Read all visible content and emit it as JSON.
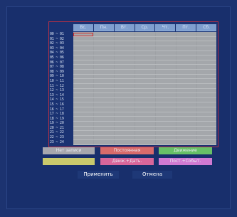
{
  "schedule": {
    "days": [
      "Вс.",
      "Пн.",
      "Вт.",
      "Ср.",
      "Чт.",
      "Пт.",
      "Сб."
    ],
    "hours": [
      "00 ~ 01",
      "01 ~ 02",
      "02 ~ 03",
      "03 ~ 04",
      "04 ~ 05",
      "05 ~ 06",
      "06 ~ 07",
      "07 ~ 08",
      "08 ~ 09",
      "09 ~ 10",
      "10 ~ 11",
      "11 ~ 12",
      "12 ~ 13",
      "13 ~ 14",
      "14 ~ 15",
      "15 ~ 16",
      "16 ~ 17",
      "17 ~ 18",
      "18 ~ 19",
      "19 ~ 20",
      "20 ~ 21",
      "21 ~ 22",
      "22 ~ 23",
      "23 ~ 24"
    ]
  },
  "modes": [
    {
      "label": "Нет записи",
      "color": "#a7a7ad"
    },
    {
      "label": "Постоянная",
      "color": "#d86b6b"
    },
    {
      "label": "Движение",
      "color": "#67c067"
    },
    {
      "label": "",
      "color": "#c9c96c"
    },
    {
      "label": "Движ.+Дать.",
      "color": "#d8669a"
    },
    {
      "label": "Пост.+Событ.",
      "color": "#d07ad2"
    }
  ],
  "actions": {
    "apply": "Применить",
    "cancel": "Отмена"
  }
}
